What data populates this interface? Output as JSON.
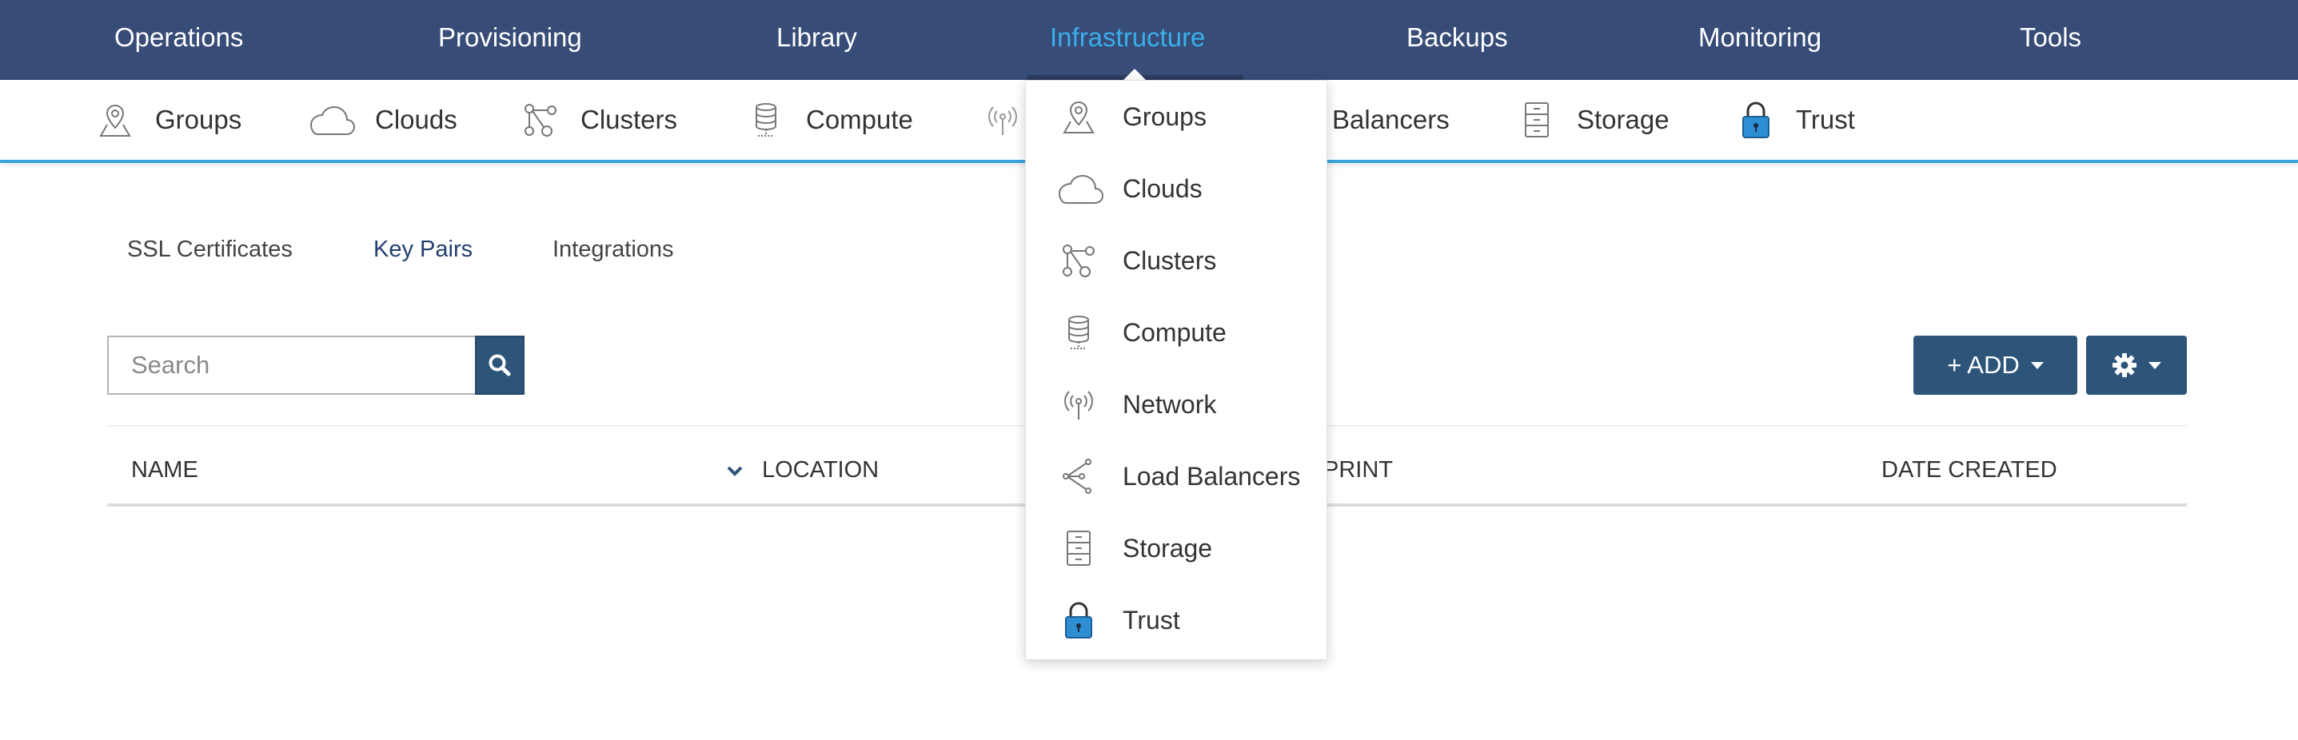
{
  "topnav": {
    "items": [
      {
        "label": "Operations"
      },
      {
        "label": "Provisioning"
      },
      {
        "label": "Library"
      },
      {
        "label": "Infrastructure",
        "active": true
      },
      {
        "label": "Backups"
      },
      {
        "label": "Monitoring"
      },
      {
        "label": "Tools"
      }
    ]
  },
  "subnav": {
    "items": [
      {
        "label": "Groups",
        "icon": "map-pin-icon"
      },
      {
        "label": "Clouds",
        "icon": "cloud-icon"
      },
      {
        "label": "Clusters",
        "icon": "cluster-icon"
      },
      {
        "label": "Compute",
        "icon": "database-icon"
      },
      {
        "label": "Balancers",
        "icon": "load-balancer-icon"
      },
      {
        "label": "Storage",
        "icon": "file-cabinet-icon"
      },
      {
        "label": "Trust",
        "icon": "lock-icon"
      }
    ]
  },
  "tabs": [
    {
      "label": "SSL Certificates"
    },
    {
      "label": "Key Pairs",
      "active": true
    },
    {
      "label": "Integrations"
    }
  ],
  "search": {
    "placeholder": "Search"
  },
  "toolbar": {
    "add_label": "+ ADD"
  },
  "table": {
    "columns": [
      {
        "label": "NAME"
      },
      {
        "label": "LOCATION",
        "sorted": "desc"
      },
      {
        "label": "PRINT"
      },
      {
        "label": "DATE CREATED"
      }
    ],
    "rows": []
  },
  "dropdown": {
    "items": [
      {
        "label": "Groups",
        "icon": "map-pin-icon"
      },
      {
        "label": "Clouds",
        "icon": "cloud-icon"
      },
      {
        "label": "Clusters",
        "icon": "cluster-icon"
      },
      {
        "label": "Compute",
        "icon": "database-icon"
      },
      {
        "label": "Network",
        "icon": "antenna-icon"
      },
      {
        "label": "Load Balancers",
        "icon": "load-balancer-icon"
      },
      {
        "label": "Storage",
        "icon": "file-cabinet-icon"
      },
      {
        "label": "Trust",
        "icon": "lock-icon"
      }
    ]
  },
  "colors": {
    "topnav_bg": "#384c78",
    "active_link": "#3aaee8",
    "button_bg": "#2c5579",
    "subnav_border": "#3aa3dc",
    "lock_fill": "#2e8ed4"
  }
}
